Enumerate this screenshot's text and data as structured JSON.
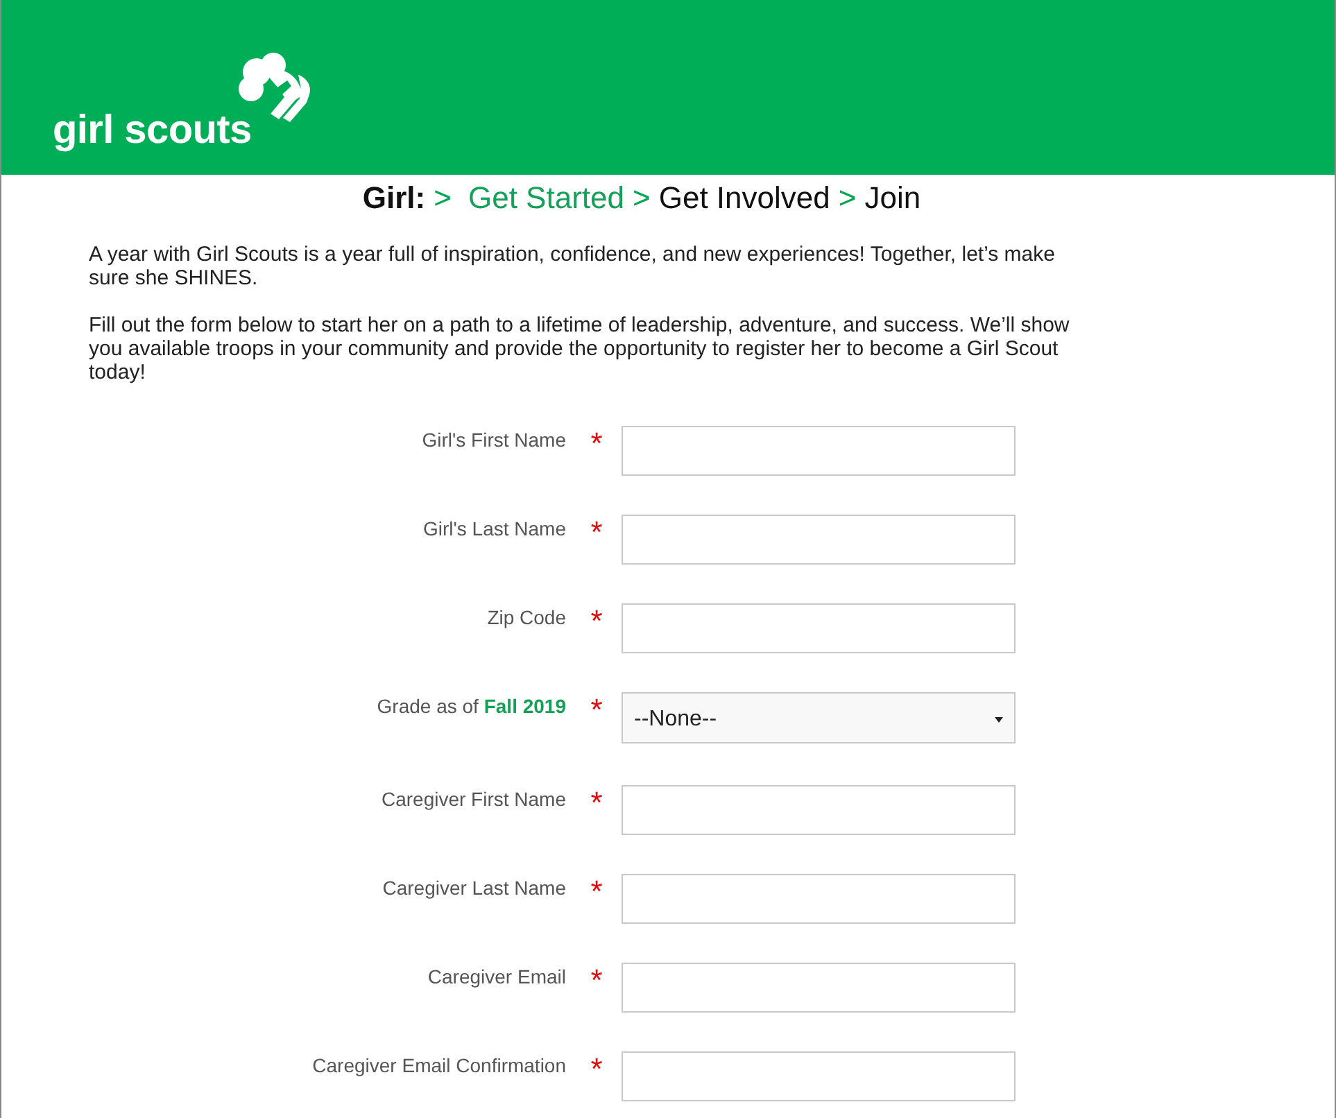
{
  "header": {
    "logo_text": "girl scouts"
  },
  "breadcrumb": {
    "title": "Girl:",
    "steps": [
      {
        "separator": ">",
        "label": "Get Started",
        "selected": true
      },
      {
        "separator": ">",
        "label": "Get Involved",
        "selected": false
      },
      {
        "separator": ">",
        "label": "Join",
        "selected": false
      }
    ]
  },
  "intro": [
    "A year with Girl Scouts is a year full of inspiration, confidence, and new experiences! Together, let’s make sure she SHINES.",
    "Fill out the form below to start her on a path to a lifetime of leadership, adventure, and success. We’ll show you available troops in your community and provide the opportunity to register her to become a Girl Scout today!"
  ],
  "form": {
    "fields": [
      {
        "kind": "text",
        "label": "Girl's First Name",
        "required_mark": "*"
      },
      {
        "kind": "text",
        "label": "Girl's Last Name",
        "required_mark": "*"
      },
      {
        "kind": "text",
        "label": "Zip Code",
        "required_mark": "*"
      },
      {
        "kind": "select",
        "label": "Grade as of",
        "highlight": "Fall 2019",
        "required_mark": "*",
        "value": "--None--"
      },
      {
        "kind": "text",
        "label": "Caregiver First Name",
        "required_mark": "*"
      },
      {
        "kind": "text",
        "label": "Caregiver Last Name",
        "required_mark": "*"
      },
      {
        "kind": "text",
        "label": "Caregiver Email",
        "required_mark": "*"
      },
      {
        "kind": "text",
        "label": "Caregiver Email Confirmation",
        "required_mark": "*"
      }
    ]
  }
}
